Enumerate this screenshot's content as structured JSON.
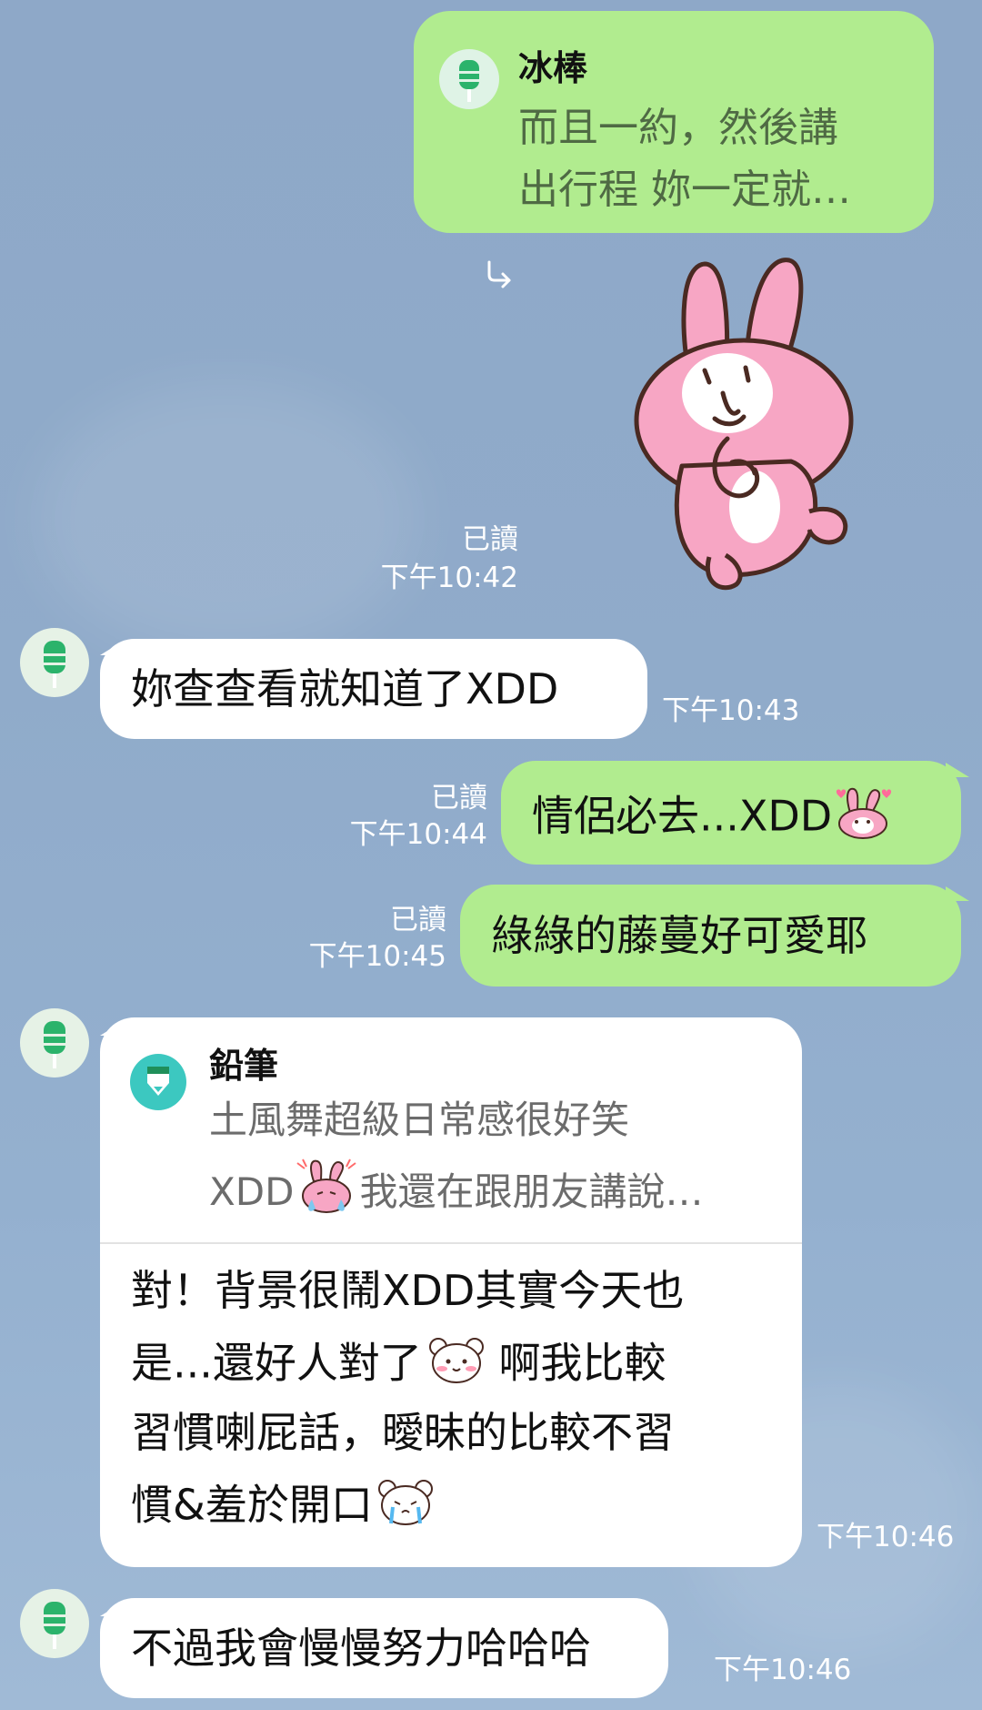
{
  "messages": {
    "m1": {
      "reply_name": "冰棒",
      "reply_line1": "而且一約，然後講",
      "reply_line2": "出行程 妳一定就…"
    },
    "m2": {
      "sticker_icon": "rabbit-thinking-sticker",
      "read": "已讀",
      "time": "下午10:42"
    },
    "m3": {
      "text": "妳查查看就知道了XDD",
      "time": "下午10:43"
    },
    "m4": {
      "text": "情侶必去...XDD",
      "read": "已讀",
      "time": "下午10:44"
    },
    "m5": {
      "text": "綠綠的藤蔓好可愛耶",
      "read": "已讀",
      "time": "下午10:45"
    },
    "m6": {
      "reply_name": "鉛筆",
      "reply_line1": "土風舞超級日常感很好笑",
      "reply_line2a": "XDD",
      "reply_line2b": "我還在跟朋友講說…",
      "line1": "對！背景很鬧XDD其實今天也",
      "line2a": "是...還好人對了",
      "line2b": " 啊我比較",
      "line3": "習慣喇屁話，曖昧的比較不習",
      "line4": "慣&羞於開口",
      "time": "下午10:46"
    },
    "m7": {
      "text": "不過我會慢慢努力哈哈哈",
      "time": "下午10:46"
    }
  },
  "colors": {
    "outgoing_bubble": "#b1ec8f",
    "incoming_bubble": "#ffffff",
    "background": "#8ea8c8",
    "avatar_green": "#2bb36b",
    "pencil_teal": "#3cc8c0"
  },
  "icons": {
    "reply_arrow": "reply-arrow-icon",
    "avatar": "popsicle-avatar-icon",
    "pencil": "pencil-avatar-icon"
  }
}
